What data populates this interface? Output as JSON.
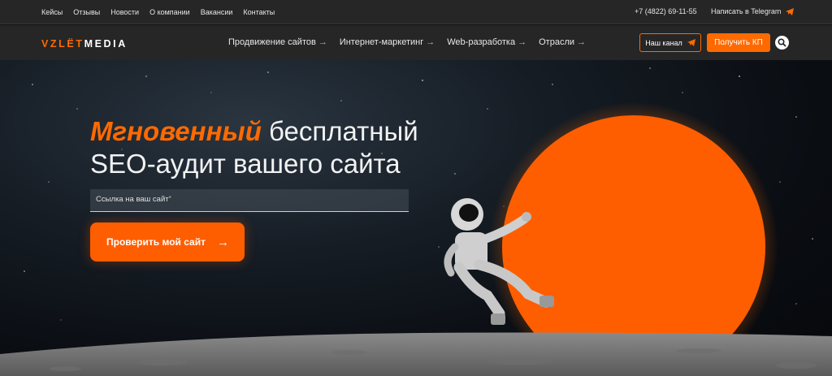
{
  "topbar": {
    "links": [
      "Кейсы",
      "Отзывы",
      "Новости",
      "О компании",
      "Вакансии",
      "Контакты"
    ],
    "phone": "+7 (4822) 69-11-55",
    "telegram_label": "Написать в Telegram"
  },
  "header": {
    "logo_part1": "VZLЁT",
    "logo_part2": "MEDIA",
    "nav": [
      "Продвижение сайтов",
      "Интернет-маркетинг",
      "Web-разработка",
      "Отрасли"
    ],
    "channel_button": "Наш канал",
    "kp_button": "Получить КП"
  },
  "hero": {
    "title_accent": "Мгновенный",
    "title_rest_1": " бесплатный",
    "title_line2": "SEO-аудит вашего сайта",
    "url_placeholder": "Ссылка на ваш сайт",
    "required_mark": "*",
    "cta_label": "Проверить мой сайт"
  },
  "colors": {
    "accent": "#ff6a00",
    "bar_bg": "#262626"
  },
  "icons": {
    "telegram": "paper-plane-icon",
    "search": "search-icon",
    "nav_arrow": "arrow-right-icon"
  }
}
